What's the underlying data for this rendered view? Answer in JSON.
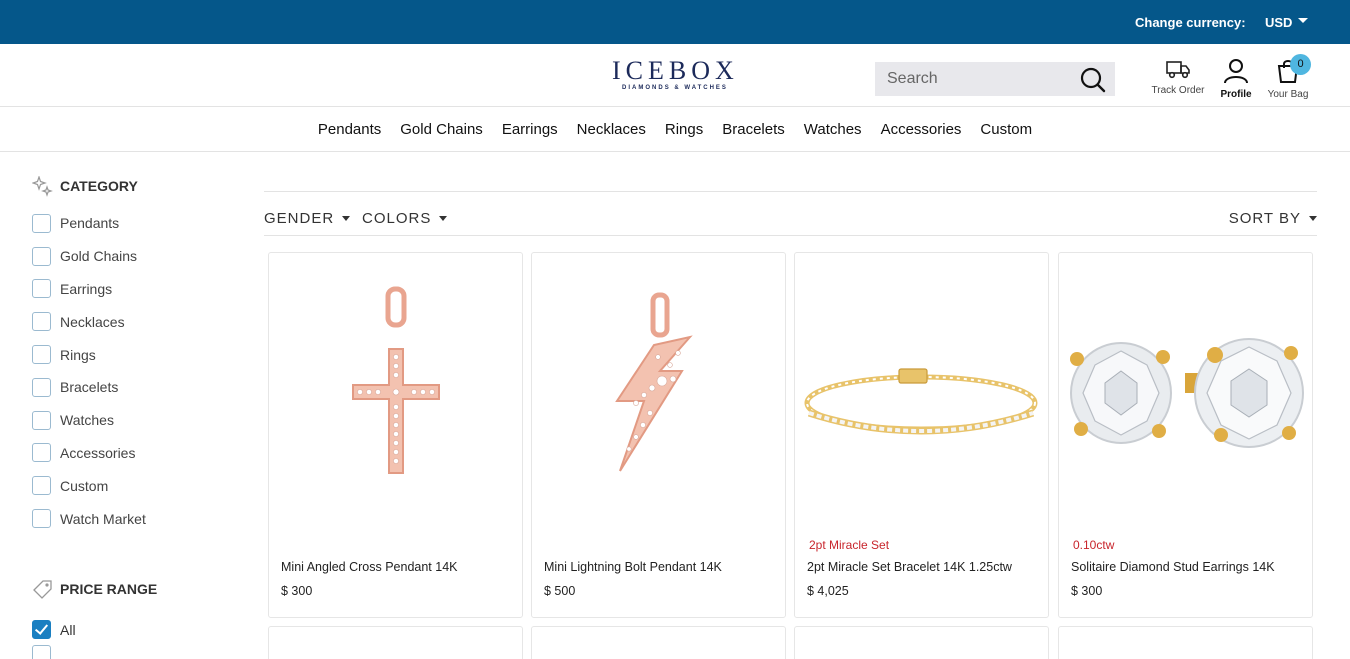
{
  "topbar": {
    "currency_label": "Change currency:",
    "currency_value": "USD",
    "bg": "#05578a"
  },
  "header": {
    "logo_brand": "ICEBOX",
    "logo_tag": "DIAMONDS & WATCHES",
    "search_placeholder": "Search",
    "track_label": "Track Order",
    "profile_label": "Profile",
    "bag_label": "Your Bag",
    "bag_count": "0"
  },
  "nav": [
    "Pendants",
    "Gold Chains",
    "Earrings",
    "Necklaces",
    "Rings",
    "Bracelets",
    "Watches",
    "Accessories",
    "Custom"
  ],
  "sidebar": {
    "category_title": "CATEGORY",
    "categories": [
      "Pendants",
      "Gold Chains",
      "Earrings",
      "Necklaces",
      "Rings",
      "Bracelets",
      "Watches",
      "Accessories",
      "Custom",
      "Watch Market"
    ],
    "price_title": "PRICE RANGE",
    "price_options": [
      {
        "label": "All",
        "checked": true
      }
    ]
  },
  "filters": {
    "gender": "GENDER",
    "colors": "COLORS",
    "sort": "SORT BY"
  },
  "products": [
    {
      "name": "Mini Angled Cross Pendant 14K",
      "price": "$ 300",
      "badge": ""
    },
    {
      "name": "Mini Lightning Bolt Pendant 14K",
      "price": "$ 500",
      "badge": ""
    },
    {
      "name": "2pt Miracle Set Bracelet 14K 1.25ctw",
      "price": "$ 4,025",
      "badge": "2pt Miracle Set"
    },
    {
      "name": "Solitaire Diamond Stud Earrings 14K",
      "price": "$ 300",
      "badge": "0.10ctw"
    }
  ],
  "colors": {
    "accent": "#05578a",
    "badge_red": "#c8252c",
    "checkbox_on": "#1a7fc1",
    "bag_badge": "#4fb6e0"
  }
}
